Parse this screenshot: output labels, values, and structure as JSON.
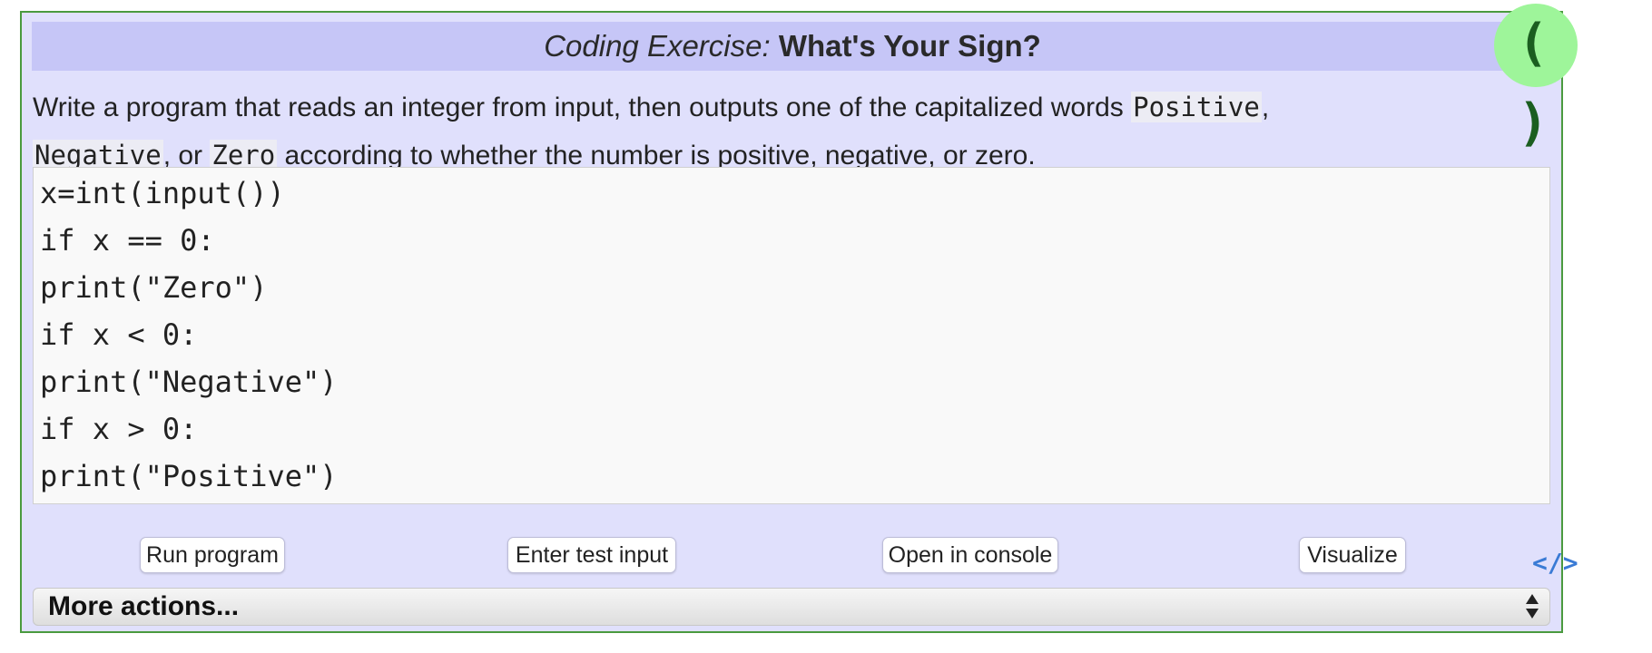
{
  "exercise": {
    "title_prefix": "Coding Exercise:",
    "title_name": "What's Your Sign?",
    "badge_icon": "parentheses-icon",
    "badge_text": "( )",
    "description": {
      "part1": "Write a program that reads an integer from input, then outputs one of the capitalized words ",
      "code_positive": "Positive",
      "part2": ",",
      "code_negative": "Negative",
      "part3": ", or ",
      "code_zero": "Zero",
      "part4": " according to whether the number is positive, negative, or zero."
    },
    "code_lines": [
      "x=int(input())",
      "if x == 0:",
      "print(\"Zero\")",
      "if x < 0:",
      "print(\"Negative\")",
      "if x > 0:",
      "print(\"Positive\")"
    ],
    "buttons": {
      "run": "Run program",
      "test_input": "Enter test input",
      "console": "Open in console",
      "visualize": "Visualize"
    },
    "code_link_icon": "code-tag-icon",
    "code_link_text": "</>",
    "more_actions": {
      "selected": "More actions..."
    }
  },
  "colors": {
    "panel_bg": "#e0e0fc",
    "title_bg": "#c6c6f7",
    "border": "#4a9a3f",
    "badge_bg": "#9ef59a",
    "badge_fg": "#1b5e20",
    "link": "#3a7bd5"
  }
}
